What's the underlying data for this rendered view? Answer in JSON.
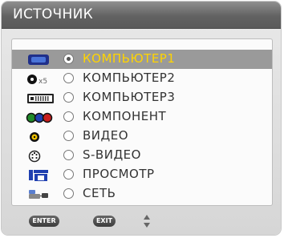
{
  "window": {
    "title": "ИСТОЧНИК"
  },
  "sources": [
    {
      "label": "КОМПЬЮТЕР1",
      "icon": "vga-connector-icon",
      "selected": true
    },
    {
      "label": "КОМПЬЮТЕР2",
      "icon": "bnc-connector-icon",
      "icon_text": "x5",
      "selected": false
    },
    {
      "label": "КОМПЬЮТЕР3",
      "icon": "dvi-connector-icon",
      "selected": false
    },
    {
      "label": "КОМПОНЕНТ",
      "icon": "component-rca-icon",
      "selected": false
    },
    {
      "label": "ВИДЕО",
      "icon": "video-rca-icon",
      "selected": false
    },
    {
      "label": "S-ВИДЕО",
      "icon": "s-video-icon",
      "selected": false
    },
    {
      "label": "ПРОСМОТР",
      "icon": "viewer-icon",
      "selected": false
    },
    {
      "label": "СЕТЬ",
      "icon": "network-icon",
      "selected": false
    }
  ],
  "footer": {
    "enter_label": "ENTER",
    "exit_label": "EXIT"
  },
  "colors": {
    "selected_text": "#ffd400",
    "selected_bg": "#9a9a9a",
    "title_bg": "#626262"
  }
}
